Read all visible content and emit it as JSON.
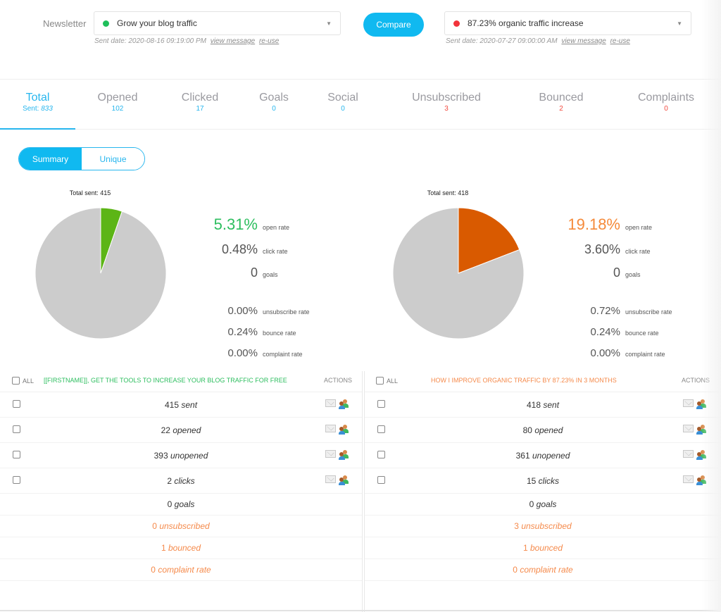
{
  "header": {
    "newsletter_label": "Newsletter",
    "campaign_a": {
      "name": "Grow your blog traffic",
      "dot_color": "#1fbf5b",
      "sent_date": "Sent date: 2020-08-16 09:19:00 PM",
      "view_message": "view message",
      "reuse": "re-use"
    },
    "compare_label": "Compare",
    "campaign_b": {
      "name": "87.23% organic traffic increase",
      "dot_color": "#f2333b",
      "sent_date": "Sent date: 2020-07-27 09:00:00 AM",
      "view_message": "view message",
      "reuse": "re-use"
    }
  },
  "tabs": [
    {
      "label": "Total",
      "prefix": "Sent: ",
      "value": "833",
      "active": true
    },
    {
      "label": "Opened",
      "value": "102"
    },
    {
      "label": "Clicked",
      "value": "17"
    },
    {
      "label": "Goals",
      "value": "0"
    },
    {
      "label": "Social",
      "value": "0"
    },
    {
      "label": "Unsubscribed",
      "value": "3"
    },
    {
      "label": "Bounced",
      "value": "2"
    },
    {
      "label": "Complaints",
      "value": "0"
    }
  ],
  "view_toggle": {
    "summary": "Summary",
    "unique": "Unique",
    "selected": "Summary"
  },
  "chart_data": [
    {
      "type": "pie",
      "title": "Total sent: 415",
      "slices": [
        {
          "label": "opened",
          "value": 22,
          "color": "#5cb516"
        },
        {
          "label": "unopened",
          "value": 393,
          "color": "#cccccc"
        }
      ]
    },
    {
      "type": "pie",
      "title": "Total sent: 418",
      "slices": [
        {
          "label": "opened",
          "value": 80,
          "color": "#d95a00"
        },
        {
          "label": "unopened",
          "value": 338,
          "color": "#cccccc"
        }
      ]
    }
  ],
  "stats_a": {
    "open_rate": "5.31%",
    "open_rate_label": "open rate",
    "open_color": "#2dbe5f",
    "click_rate": "0.48%",
    "click_rate_label": "click rate",
    "goals": "0",
    "goals_label": "goals",
    "unsubscribe_rate": "0.00%",
    "unsubscribe_rate_label": "unsubscribe rate",
    "bounce_rate": "0.24%",
    "bounce_rate_label": "bounce rate",
    "complaint_rate": "0.00%",
    "complaint_rate_label": "complaint rate"
  },
  "stats_b": {
    "open_rate": "19.18%",
    "open_rate_label": "open rate",
    "open_color": "#f58a3a",
    "click_rate": "3.60%",
    "click_rate_label": "click rate",
    "goals": "0",
    "goals_label": "goals",
    "unsubscribe_rate": "0.72%",
    "unsubscribe_rate_label": "unsubscribe rate",
    "bounce_rate": "0.24%",
    "bounce_rate_label": "bounce rate",
    "complaint_rate": "0.00%",
    "complaint_rate_label": "complaint rate"
  },
  "table_a": {
    "all_label": "ALL",
    "subject": "[[FIRSTNAME]], GET THE TOOLS TO INCREASE YOUR BLOG TRAFFIC FOR FREE",
    "subject_color": "#2dbe5f",
    "actions_label": "ACTIONS",
    "rows": [
      {
        "num": "415",
        "label": "sent"
      },
      {
        "num": "22",
        "label": "opened"
      },
      {
        "num": "393",
        "label": "unopened"
      },
      {
        "num": "2",
        "label": "clicks"
      },
      {
        "num": "0",
        "label": "goals"
      },
      {
        "num": "0",
        "label": "unsubscribed"
      },
      {
        "num": "1",
        "label": "bounced"
      },
      {
        "num": "0",
        "label": "complaint rate"
      }
    ]
  },
  "table_b": {
    "all_label": "ALL",
    "subject": "HOW I IMPROVE ORGANIC TRAFFIC BY 87.23% IN 3 MONTHS",
    "subject_color": "#f58a4b",
    "actions_label": "ACTIONS",
    "rows": [
      {
        "num": "418",
        "label": "sent"
      },
      {
        "num": "80",
        "label": "opened"
      },
      {
        "num": "361",
        "label": "unopened"
      },
      {
        "num": "15",
        "label": "clicks"
      },
      {
        "num": "0",
        "label": "goals"
      },
      {
        "num": "3",
        "label": "unsubscribed"
      },
      {
        "num": "1",
        "label": "bounced"
      },
      {
        "num": "0",
        "label": "complaint rate"
      }
    ]
  }
}
